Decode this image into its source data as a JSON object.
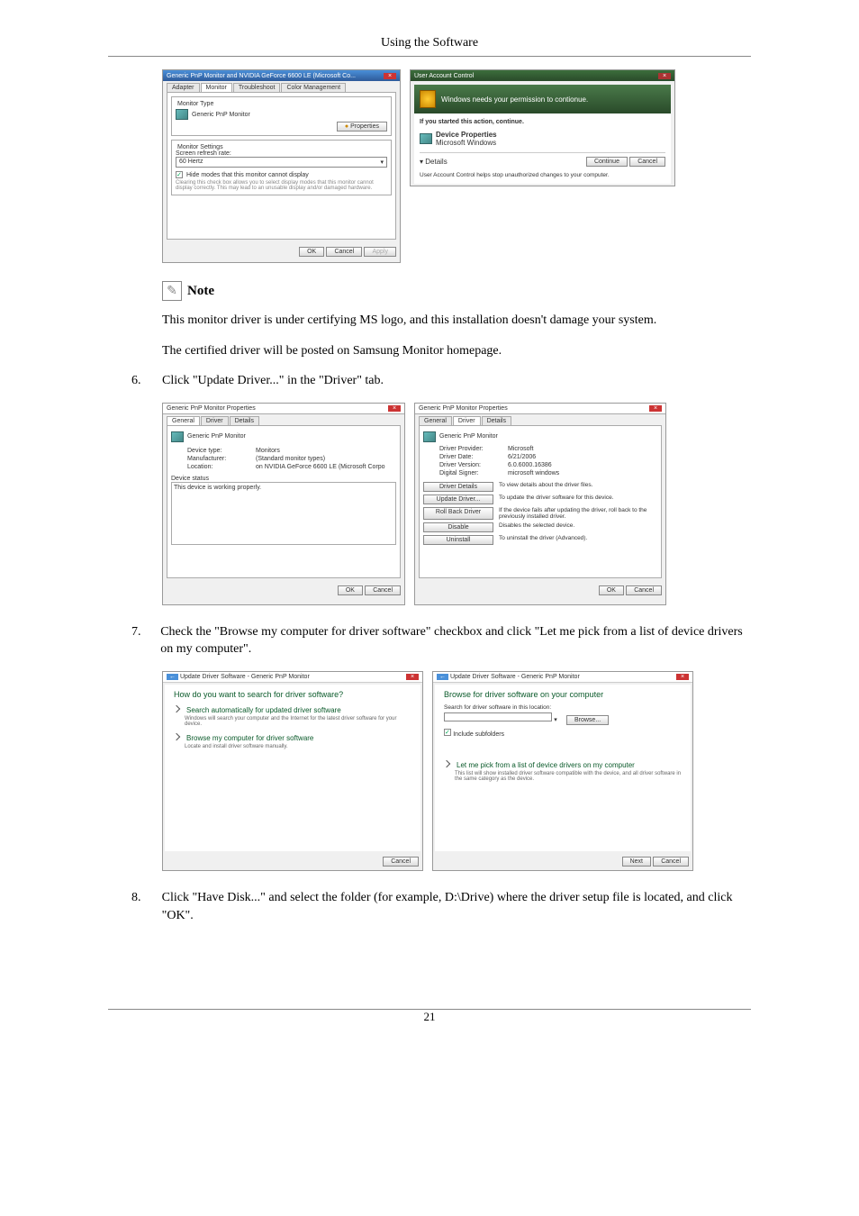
{
  "header": {
    "title": "Using the Software"
  },
  "dialog1": {
    "title": "Generic PnP Monitor and NVIDIA GeForce 6600 LE (Microsoft Co...",
    "tabs": [
      "Adapter",
      "Monitor",
      "Troubleshoot",
      "Color Management"
    ],
    "section1_label": "Monitor Type",
    "monitor_name": "Generic PnP Monitor",
    "properties_btn": "Properties",
    "section2_label": "Monitor Settings",
    "refresh_label": "Screen refresh rate:",
    "refresh_value": "60 Hertz",
    "hide_check": "Hide modes that this monitor cannot display",
    "hide_desc": "Clearing this check box allows you to select display modes that this monitor cannot display correctly. This may lead to an unusable display and/or damaged hardware.",
    "ok": "OK",
    "cancel": "Cancel",
    "apply": "Apply"
  },
  "uac": {
    "title": "User Account Control",
    "banner": "Windows needs your permission to contionue.",
    "line1": "If you started this action, continue.",
    "app_name": "Device Properties",
    "app_pub": "Microsoft Windows",
    "details": "Details",
    "continue": "Continue",
    "cancel": "Cancel",
    "footer": "User Account Control helps stop unauthorized changes to your computer."
  },
  "note": {
    "label": "Note"
  },
  "note_body1": "This monitor driver is under certifying MS logo, and this installation doesn't damage your system.",
  "note_body2": "The certified driver will be posted on Samsung Monitor homepage.",
  "step6": {
    "num": "6.",
    "text": "Click \"Update Driver...\" in the \"Driver\" tab."
  },
  "props_general": {
    "title": "Generic PnP Monitor Properties",
    "tabs": [
      "General",
      "Driver",
      "Details"
    ],
    "header": "Generic PnP Monitor",
    "dtype_l": "Device type:",
    "dtype_v": "Monitors",
    "manu_l": "Manufacturer:",
    "manu_v": "(Standard monitor types)",
    "loc_l": "Location:",
    "loc_v": "on NVIDIA GeForce 6600 LE (Microsoft Corpo",
    "status_l": "Device status",
    "status_v": "This device is working properly.",
    "ok": "OK",
    "cancel": "Cancel"
  },
  "props_driver": {
    "title": "Generic PnP Monitor Properties",
    "tabs": [
      "General",
      "Driver",
      "Details"
    ],
    "header": "Generic PnP Monitor",
    "prov_l": "Driver Provider:",
    "prov_v": "Microsoft",
    "date_l": "Driver Date:",
    "date_v": "6/21/2006",
    "ver_l": "Driver Version:",
    "ver_v": "6.0.6000.16386",
    "sig_l": "Digital Signer:",
    "sig_v": "microsoft windows",
    "b_details": "Driver Details",
    "d_details": "To view details about the driver files.",
    "b_update": "Update Driver...",
    "d_update": "To update the driver software for this device.",
    "b_roll": "Roll Back Driver",
    "d_roll": "If the device fails after updating the driver, roll back to the previously installed driver.",
    "b_dis": "Disable",
    "d_dis": "Disables the selected device.",
    "b_un": "Uninstall",
    "d_un": "To uninstall the driver (Advanced).",
    "ok": "OK",
    "cancel": "Cancel"
  },
  "step7": {
    "num": "7.",
    "text": "Check the \"Browse my computer for driver software\" checkbox and click \"Let me pick from a list of device drivers on my computer\"."
  },
  "updsw1": {
    "title": "Update Driver Software - Generic PnP Monitor",
    "heading": "How do you want to search for driver software?",
    "opt1": "Search automatically for updated driver software",
    "opt1_sub": "Windows will search your computer and the Internet for the latest driver software for your device.",
    "opt2": "Browse my computer for driver software",
    "opt2_sub": "Locate and install driver software manually.",
    "cancel": "Cancel"
  },
  "updsw2": {
    "title": "Update Driver Software - Generic PnP Monitor",
    "heading": "Browse for driver software on your computer",
    "search_l": "Search for driver software in this location:",
    "browse": "Browse...",
    "include": "Include subfolders",
    "opt1": "Let me pick from a list of device drivers on my computer",
    "opt1_sub": "This list will show installed driver software compatible with the device, and all driver software in the same category as the device.",
    "next": "Next",
    "cancel": "Cancel"
  },
  "step8": {
    "num": "8.",
    "text": "Click \"Have Disk...\" and select the folder (for example, D:\\Drive) where the driver setup file is located, and click \"OK\"."
  },
  "footer": {
    "page": "21"
  }
}
